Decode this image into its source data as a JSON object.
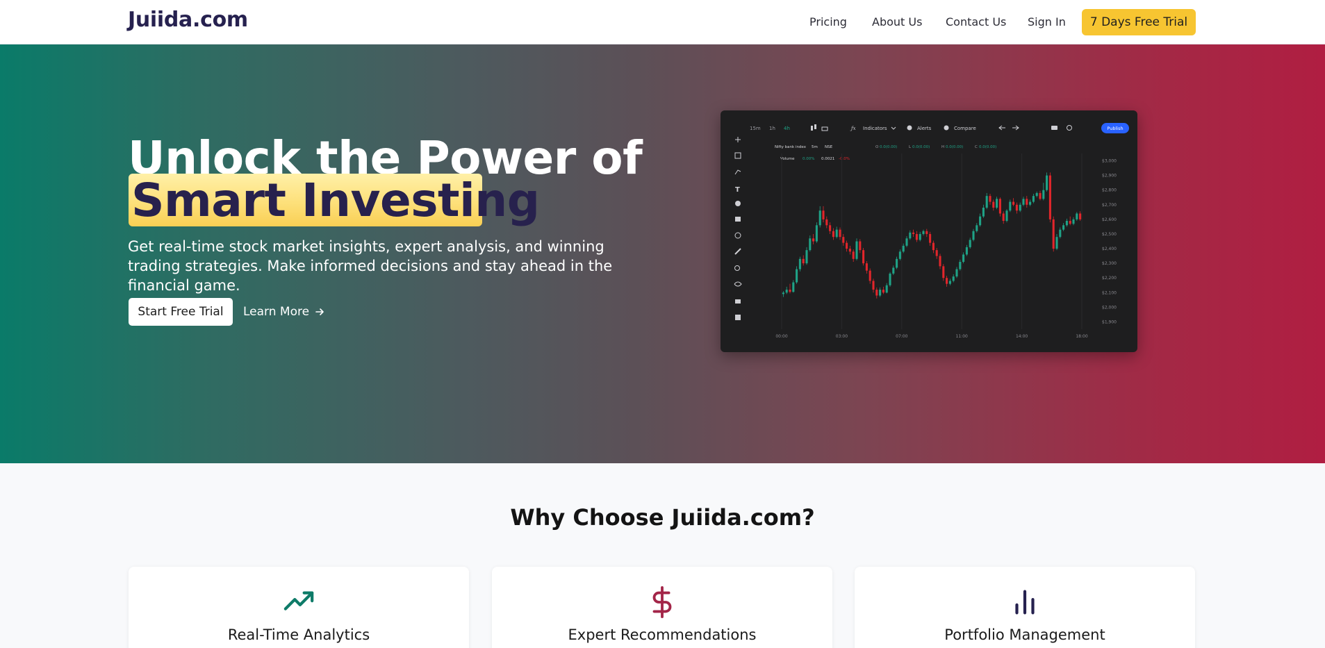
{
  "brand": {
    "name": "Juiida.com"
  },
  "nav": {
    "links": [
      "Pricing",
      "About Us",
      "Contact Us",
      "Sign In"
    ],
    "cta": "7 Days Free Trial"
  },
  "hero": {
    "title_line1": "Unlock the Power of",
    "title_highlight": "Smart Investing",
    "subtitle": "Get real-time stock market insights, expert analysis, and winning trading strategies. Make informed decisions and stay ahead in the financial game.",
    "primary_button": "Start Free Trial",
    "secondary_button": "Learn More",
    "secondary_icon": "arrow-right-icon"
  },
  "chart_preview": {
    "toolbar": {
      "timeframes": [
        "15m",
        "1h",
        "4h"
      ],
      "indicators": "Indicators",
      "alerts": "Alerts",
      "compare": "Compare",
      "publish": "Publish"
    },
    "symbol": {
      "name": "Nifty bank index",
      "interval": "5m",
      "exchange": "NSE"
    },
    "volume_label": "Volume",
    "volume_values": [
      "0.00%",
      "0.0021",
      "-0.0%"
    ],
    "ohlc": {
      "O": "0.0(0.00)",
      "L": "0.0(0.00)",
      "H": "0.0(0.00)",
      "C": "0.0(0.00)"
    },
    "colors": {
      "up": "#1fa387",
      "down": "#e2262b",
      "background": "#1e1e1f",
      "publish": "#2962ff"
    }
  },
  "chart_data": {
    "type": "candlestick",
    "x_ticks": [
      "00:00",
      "03:00",
      "07:00",
      "11:00",
      "14:00",
      "18:00"
    ],
    "y_ticks": [
      "$3,000",
      "$2,900",
      "$2,800",
      "$2,700",
      "$2,600",
      "$2,500",
      "$2,400",
      "$2,300",
      "$2,200",
      "$2,100",
      "$2,000",
      "$1,900"
    ],
    "ylim": [
      1850,
      3050
    ],
    "candles": [
      [
        2090,
        2100,
        2070,
        2110
      ],
      [
        2100,
        2120,
        2090,
        2140
      ],
      [
        2120,
        2105,
        2095,
        2160
      ],
      [
        2105,
        2170,
        2100,
        2185
      ],
      [
        2170,
        2260,
        2160,
        2280
      ],
      [
        2260,
        2330,
        2245,
        2345
      ],
      [
        2330,
        2300,
        2285,
        2355
      ],
      [
        2300,
        2390,
        2290,
        2410
      ],
      [
        2390,
        2470,
        2380,
        2490
      ],
      [
        2470,
        2450,
        2430,
        2500
      ],
      [
        2450,
        2560,
        2440,
        2580
      ],
      [
        2560,
        2660,
        2545,
        2690
      ],
      [
        2660,
        2600,
        2580,
        2690
      ],
      [
        2600,
        2560,
        2540,
        2620
      ],
      [
        2560,
        2520,
        2500,
        2580
      ],
      [
        2520,
        2480,
        2460,
        2540
      ],
      [
        2480,
        2530,
        2470,
        2550
      ],
      [
        2530,
        2480,
        2460,
        2545
      ],
      [
        2480,
        2440,
        2420,
        2500
      ],
      [
        2440,
        2400,
        2380,
        2455
      ],
      [
        2400,
        2380,
        2360,
        2420
      ],
      [
        2380,
        2330,
        2310,
        2395
      ],
      [
        2330,
        2450,
        2320,
        2470
      ],
      [
        2450,
        2390,
        2370,
        2465
      ],
      [
        2390,
        2300,
        2285,
        2405
      ],
      [
        2300,
        2250,
        2230,
        2315
      ],
      [
        2250,
        2180,
        2160,
        2265
      ],
      [
        2180,
        2120,
        2100,
        2195
      ],
      [
        2120,
        2080,
        2060,
        2135
      ],
      [
        2080,
        2120,
        2070,
        2135
      ],
      [
        2120,
        2100,
        2090,
        2140
      ],
      [
        2100,
        2150,
        2095,
        2165
      ],
      [
        2150,
        2230,
        2140,
        2240
      ],
      [
        2230,
        2270,
        2220,
        2285
      ],
      [
        2270,
        2330,
        2260,
        2345
      ],
      [
        2330,
        2380,
        2320,
        2395
      ],
      [
        2380,
        2420,
        2370,
        2435
      ],
      [
        2420,
        2470,
        2410,
        2485
      ],
      [
        2470,
        2510,
        2460,
        2525
      ],
      [
        2510,
        2500,
        2480,
        2530
      ],
      [
        2500,
        2460,
        2445,
        2520
      ],
      [
        2460,
        2500,
        2450,
        2515
      ],
      [
        2500,
        2520,
        2490,
        2530
      ],
      [
        2520,
        2500,
        2480,
        2535
      ],
      [
        2500,
        2440,
        2420,
        2515
      ],
      [
        2440,
        2390,
        2370,
        2455
      ],
      [
        2390,
        2350,
        2330,
        2405
      ],
      [
        2350,
        2280,
        2260,
        2365
      ],
      [
        2280,
        2200,
        2180,
        2295
      ],
      [
        2200,
        2160,
        2140,
        2215
      ],
      [
        2160,
        2180,
        2150,
        2195
      ],
      [
        2180,
        2210,
        2170,
        2225
      ],
      [
        2210,
        2260,
        2200,
        2275
      ],
      [
        2260,
        2310,
        2250,
        2325
      ],
      [
        2310,
        2360,
        2300,
        2375
      ],
      [
        2360,
        2410,
        2350,
        2425
      ],
      [
        2410,
        2460,
        2400,
        2475
      ],
      [
        2460,
        2520,
        2450,
        2535
      ],
      [
        2520,
        2560,
        2510,
        2575
      ],
      [
        2560,
        2620,
        2550,
        2640
      ],
      [
        2620,
        2680,
        2610,
        2700
      ],
      [
        2680,
        2760,
        2670,
        2780
      ],
      [
        2760,
        2720,
        2700,
        2775
      ],
      [
        2720,
        2680,
        2660,
        2735
      ],
      [
        2680,
        2740,
        2670,
        2755
      ],
      [
        2740,
        2640,
        2620,
        2750
      ],
      [
        2640,
        2590,
        2570,
        2655
      ],
      [
        2590,
        2660,
        2580,
        2670
      ],
      [
        2660,
        2720,
        2650,
        2735
      ],
      [
        2720,
        2700,
        2690,
        2745
      ],
      [
        2700,
        2660,
        2640,
        2715
      ],
      [
        2660,
        2700,
        2650,
        2715
      ],
      [
        2700,
        2740,
        2690,
        2755
      ],
      [
        2740,
        2700,
        2680,
        2760
      ],
      [
        2700,
        2720,
        2690,
        2735
      ],
      [
        2720,
        2760,
        2710,
        2775
      ],
      [
        2760,
        2780,
        2750,
        2790
      ],
      [
        2780,
        2740,
        2730,
        2795
      ],
      [
        2740,
        2800,
        2730,
        2850
      ],
      [
        2800,
        2900,
        2790,
        2920
      ],
      [
        2900,
        2600,
        2580,
        2920
      ],
      [
        2600,
        2400,
        2380,
        2620
      ],
      [
        2400,
        2480,
        2390,
        2500
      ],
      [
        2480,
        2530,
        2470,
        2545
      ],
      [
        2530,
        2560,
        2520,
        2575
      ],
      [
        2560,
        2590,
        2550,
        2605
      ],
      [
        2590,
        2570,
        2560,
        2620
      ],
      [
        2570,
        2600,
        2560,
        2615
      ],
      [
        2600,
        2640,
        2590,
        2650
      ],
      [
        2640,
        2600,
        2590,
        2655
      ]
    ]
  },
  "features": {
    "title": "Why Choose Juiida.com?",
    "cards": [
      {
        "title": "Real-Time Analytics",
        "icon": "trending-up-icon",
        "color": "#0e7b68"
      },
      {
        "title": "Expert Recommendations",
        "icon": "dollar-sign-icon",
        "color": "#a32548"
      },
      {
        "title": "Portfolio Management",
        "icon": "bar-chart-icon",
        "color": "#26214f"
      }
    ]
  }
}
